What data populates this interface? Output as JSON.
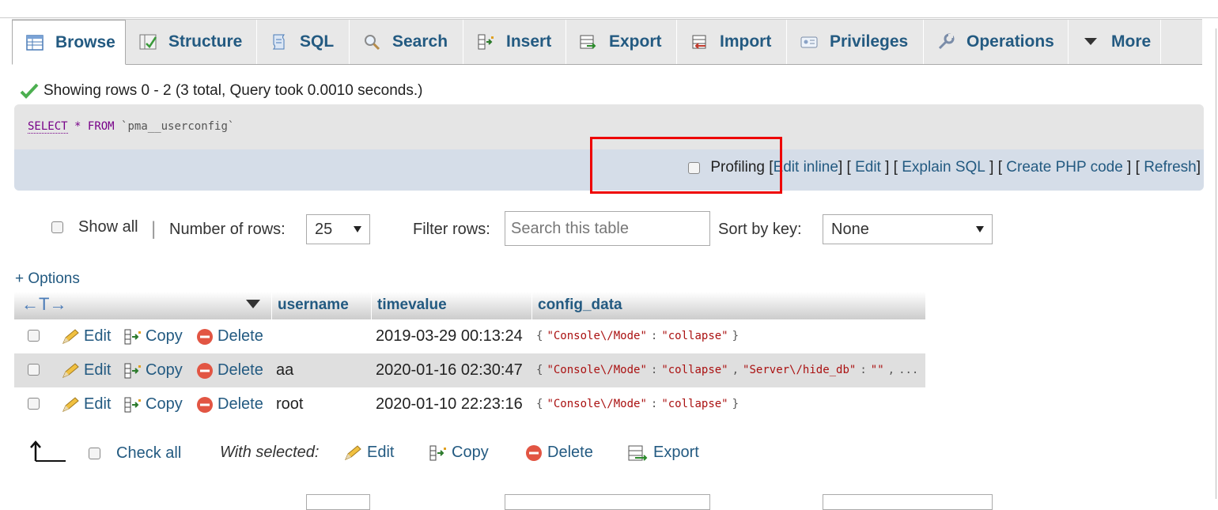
{
  "tabs": [
    {
      "label": "Browse",
      "icon": "browse-icon"
    },
    {
      "label": "Structure",
      "icon": "structure-icon"
    },
    {
      "label": "SQL",
      "icon": "sql-icon"
    },
    {
      "label": "Search",
      "icon": "search-icon"
    },
    {
      "label": "Insert",
      "icon": "insert-icon"
    },
    {
      "label": "Export",
      "icon": "export-icon"
    },
    {
      "label": "Import",
      "icon": "import-icon"
    },
    {
      "label": "Privileges",
      "icon": "privileges-icon"
    },
    {
      "label": "Operations",
      "icon": "operations-icon"
    },
    {
      "label": "More",
      "icon": "caret-down-icon"
    }
  ],
  "status": {
    "message": "Showing rows 0 - 2 (3 total, Query took 0.0010 seconds.)"
  },
  "sql": {
    "keyword_select": "SELECT",
    "star": "*",
    "keyword_from": "FROM",
    "table": "`pma__userconfig`"
  },
  "links": {
    "profiling": "Profiling",
    "edit_inline": "Edit inline",
    "edit": "Edit",
    "explain_sql": "Explain SQL",
    "create_php": "Create PHP code",
    "refresh": "Refresh"
  },
  "nav": {
    "show_all": "Show all",
    "separator": "|",
    "number_of_rows_label": "Number of rows:",
    "number_of_rows_value": "25",
    "filter_label": "Filter rows:",
    "filter_placeholder": "Search this table",
    "sort_label": "Sort by key:",
    "sort_value": "None"
  },
  "options": {
    "label": "+ Options"
  },
  "table": {
    "resize_glyph": "←T→",
    "columns": [
      "username",
      "timevalue",
      "config_data"
    ],
    "action_labels": {
      "edit": "Edit",
      "copy": "Copy",
      "delete": "Delete"
    },
    "rows": [
      {
        "username": "",
        "timevalue": "2019-03-29 00:13:24",
        "config": "{\"Console\\/Mode\":\"collapse\"}"
      },
      {
        "username": "aa",
        "timevalue": "2020-01-16 02:30:47",
        "config": "{\"Console\\/Mode\":\"collapse\",\"Server\\/hide_db\":\"\",\"..."
      },
      {
        "username": "root",
        "timevalue": "2020-01-10 22:23:16",
        "config": "{\"Console\\/Mode\":\"collapse\"}"
      }
    ]
  },
  "footer": {
    "check_all": "Check all",
    "with_selected": "With selected:",
    "edit": "Edit",
    "copy": "Copy",
    "delete": "Delete",
    "export": "Export"
  },
  "colors": {
    "link": "#235a81",
    "highlight_box": "#e00000",
    "success": "#4caf50",
    "delete": "#e25543"
  }
}
